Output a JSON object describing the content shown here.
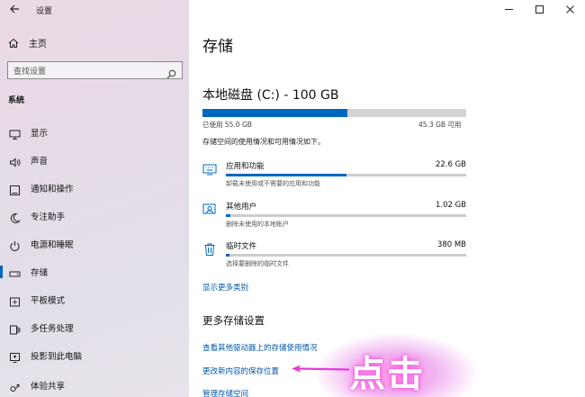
{
  "sidebar": {
    "app_title": "设置",
    "home_label": "主页",
    "search_placeholder": "查找设置",
    "section_label": "系统",
    "items": [
      {
        "label": "显示",
        "icon": "monitor-icon"
      },
      {
        "label": "声音",
        "icon": "speaker-icon"
      },
      {
        "label": "通知和操作",
        "icon": "notification-icon"
      },
      {
        "label": "专注助手",
        "icon": "moon-icon"
      },
      {
        "label": "电源和睡眠",
        "icon": "power-icon"
      },
      {
        "label": "存储",
        "icon": "drive-icon",
        "selected": true
      },
      {
        "label": "平板模式",
        "icon": "tablet-icon"
      },
      {
        "label": "多任务处理",
        "icon": "multitask-icon"
      },
      {
        "label": "投影到此电脑",
        "icon": "project-icon"
      },
      {
        "label": "体验共享",
        "icon": "share-icon"
      }
    ]
  },
  "main": {
    "page_title": "存储",
    "drive_title": "本地磁盘 (C:) - 100 GB",
    "drive_used": "已使用 55.0 GB",
    "drive_free": "45.3 GB 可用",
    "drive_used_fraction": 0.55,
    "drive_desc": "存储空间的使用情况和可用情况如下。",
    "categories": [
      {
        "name": "应用和功能",
        "size": "22.6 GB",
        "sub": "卸载未使用或不需要的应用和功能",
        "fraction": 0.5,
        "icon": "keyboard-icon"
      },
      {
        "name": "其他用户",
        "size": "1.02 GB",
        "sub": "删除未使用的本地帐户",
        "fraction": 0.02,
        "icon": "user-icon"
      },
      {
        "name": "临时文件",
        "size": "380 MB",
        "sub": "选择要删除的临时文件",
        "fraction": 0.01,
        "icon": "trash-icon"
      }
    ],
    "show_more": "显示更多类别",
    "more_settings_title": "更多存储设置",
    "links": [
      "查看其他驱动器上的存储使用情况",
      "更改新内容的保存位置",
      "管理存储空间"
    ]
  },
  "annotation": {
    "text": "点击"
  },
  "colors": {
    "accent": "#0067c0",
    "link": "#0057a6"
  }
}
